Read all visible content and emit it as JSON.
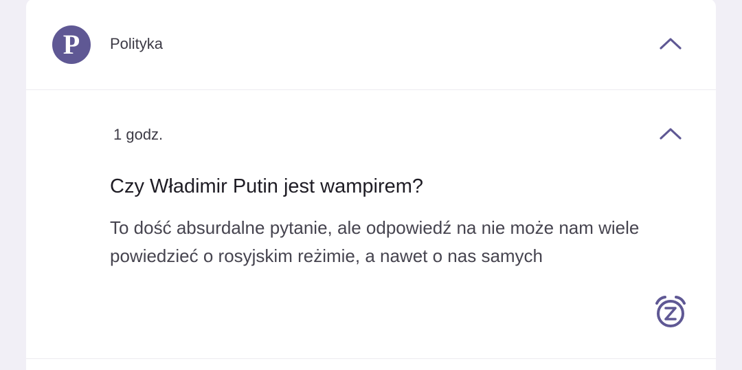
{
  "notification_group": {
    "app_initial": "P",
    "app_name": "Polityka",
    "collapse_icon": "chevron-up-icon"
  },
  "notification": {
    "time": "1 godz.",
    "title": "Czy Władimir Putin jest wampirem?",
    "body": "To dość absurdalne pytanie, ale odpowiedź na nie może nam wiele powiedzieć o rosyjskim reżimie, a nawet o nas samych",
    "collapse_icon": "chevron-up-icon",
    "snooze_icon": "snooze-alarm-icon"
  },
  "colors": {
    "accent": "#5f5894",
    "background": "#f1eff6",
    "card": "#ffffff",
    "text_primary": "#1e1c24",
    "text_secondary": "#46444f"
  }
}
